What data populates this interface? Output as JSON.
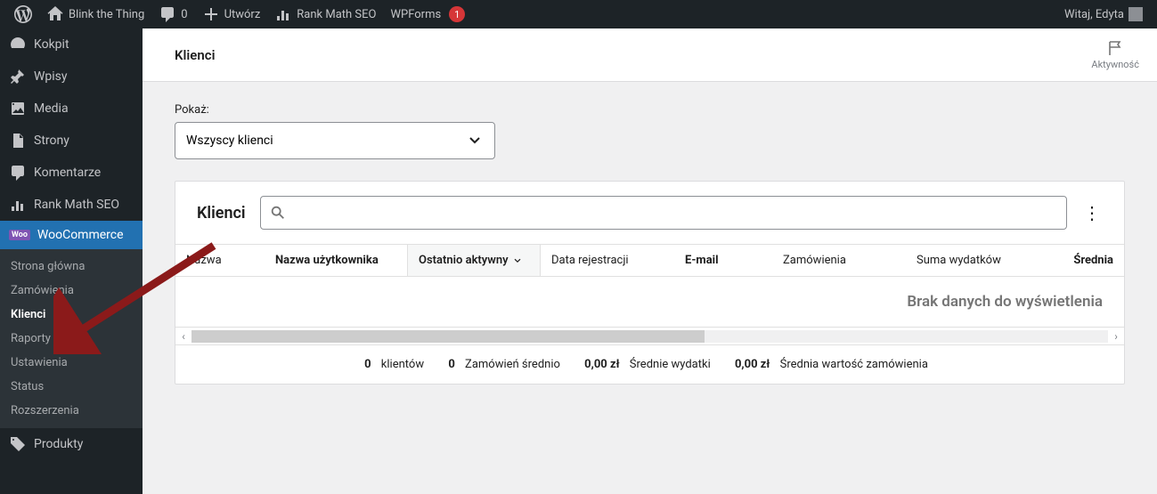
{
  "adminbar": {
    "site_name": "Blink the Thing",
    "comments_count": "0",
    "create": "Utwórz",
    "rankmath": "Rank Math SEO",
    "wpforms": "WPForms",
    "wpforms_badge": "1",
    "greeting": "Witaj, Edyta"
  },
  "sidebar": {
    "dashboard": "Kokpit",
    "posts": "Wpisy",
    "media": "Media",
    "pages": "Strony",
    "comments": "Komentarze",
    "rankmath": "Rank Math SEO",
    "woocommerce": "WooCommerce",
    "products": "Produkty",
    "submenu": {
      "home": "Strona główna",
      "orders": "Zamówienia",
      "customers": "Klienci",
      "reports": "Raporty",
      "settings": "Ustawienia",
      "status": "Status",
      "extensions": "Rozszerzenia"
    }
  },
  "page": {
    "title": "Klienci",
    "activity": "Aktywność",
    "show_label": "Pokaż:",
    "filter_value": "Wszyscy klienci",
    "panel_title": "Klienci",
    "columns": {
      "name": "Nazwa",
      "username": "Nazwa użytkownika",
      "last_active": "Ostatnio aktywny",
      "reg_date": "Data rejestracji",
      "email": "E-mail",
      "orders": "Zamówienia",
      "total_spend": "Suma wydatków",
      "average": "Średnia"
    },
    "empty_message": "Brak danych do wyświetlenia",
    "summary": {
      "customers_n": "0",
      "customers_label": "klientów",
      "avg_orders_n": "0",
      "avg_orders_label": "Zamówień średnio",
      "avg_spend_n": "0,00 zł",
      "avg_spend_label": "Średnie wydatki",
      "avg_order_val_n": "0,00 zł",
      "avg_order_val_label": "Średnia wartość zamówienia"
    }
  }
}
